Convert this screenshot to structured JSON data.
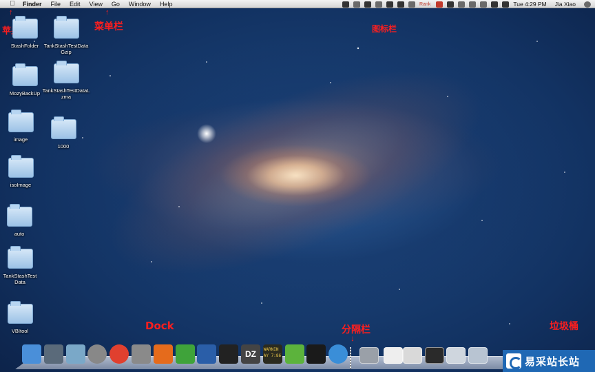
{
  "menubar": {
    "apple_icon": "apple-logo",
    "items": [
      "Finder",
      "File",
      "Edit",
      "View",
      "Go",
      "Window",
      "Help"
    ],
    "status": {
      "rank_text": "Rank",
      "clock": "Tue 4:29 PM",
      "user": "Jia Xiao"
    }
  },
  "annotations": {
    "apple_menu": "苹果菜单",
    "menu_bar": "菜单栏",
    "icon_bar": "图标栏",
    "dock": "Dock",
    "separator": "分隔栏",
    "trash": "垃圾桶",
    "color": "#ff1e1e"
  },
  "desktop": {
    "icons": [
      {
        "label": "StashFolder"
      },
      {
        "label": "TankStashTestDataGzip"
      },
      {
        "label": "MozyBackUp"
      },
      {
        "label": "TankStashTestDataLzma"
      },
      {
        "label": "image"
      },
      {
        "label": "1000"
      },
      {
        "label": "isoImage"
      },
      {
        "label": "auto"
      },
      {
        "label": "TankStashTestData"
      },
      {
        "label": "VBItool"
      }
    ]
  },
  "dock": {
    "apps": [
      {
        "name": "finder-icon",
        "color": "#4a8fd9"
      },
      {
        "name": "system-utility-icon",
        "color": "#5a6a7a"
      },
      {
        "name": "keychain-icon",
        "color": "#7aa8c8"
      },
      {
        "name": "launchpad-icon",
        "color": "#888888"
      },
      {
        "name": "chrome-icon",
        "color": "#e0402f"
      },
      {
        "name": "system-preferences-icon",
        "color": "#8a8a8a"
      },
      {
        "name": "firefox-icon",
        "color": "#e56b1c"
      },
      {
        "name": "adium-duck-icon",
        "color": "#3fa33a"
      },
      {
        "name": "virtualbox-icon",
        "color": "#2a5ea8"
      },
      {
        "name": "terminal-icon",
        "color": "#222222"
      },
      {
        "name": "dz-app-icon",
        "color": "#444444"
      },
      {
        "name": "console-icon",
        "color": "#2b2b1f"
      },
      {
        "name": "evernote-icon",
        "color": "#5cb33c"
      },
      {
        "name": "terminal-2-icon",
        "color": "#1a1a1a"
      },
      {
        "name": "safari-icon",
        "color": "#3a8ed8"
      }
    ],
    "console_text": "WARNIN",
    "console_time": "AY 7:86",
    "dz_text": "DZ",
    "right_items": [
      {
        "name": "folder-stack-icon",
        "color": "#9aa0a8"
      },
      {
        "name": "document-icon",
        "color": "#eeeeee"
      },
      {
        "name": "window-thumb-1",
        "color": "#d9d9d9"
      },
      {
        "name": "window-thumb-2",
        "color": "#2a2a2a"
      },
      {
        "name": "window-thumb-3",
        "color": "#cfd6de"
      },
      {
        "name": "window-thumb-4",
        "color": "#b8c4d2"
      }
    ]
  },
  "watermark": {
    "text": "易采站长站",
    "bg": "#1f68b4"
  }
}
